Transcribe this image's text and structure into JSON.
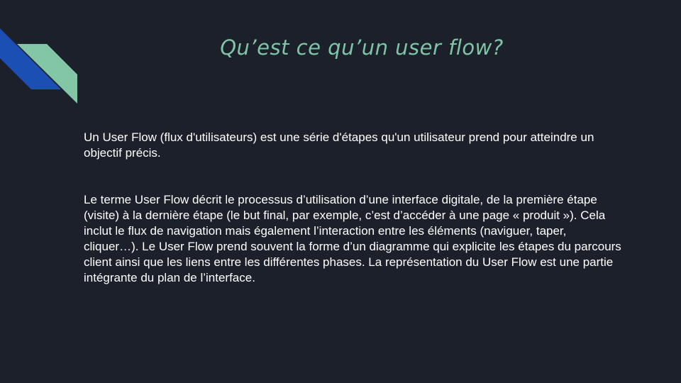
{
  "slide": {
    "title": "Qu’est ce qu’un user flow?",
    "paragraphs": [
      "Un User Flow (flux d'utilisateurs) est une série d'étapes qu'un utilisateur prend pour atteindre un objectif précis.",
      "Le terme User Flow décrit le processus d’utilisation d’une interface digitale, de la première étape (visite) à la dernière étape (le but final, par exemple, c’est d’accéder à une page « produit »). Cela inclut le flux de navigation mais également l’interaction entre les éléments (naviguer, taper, cliquer…). Le User Flow prend souvent la forme d’un diagramme qui explicite les étapes du parcours client ainsi que les liens entre les différentes phases. La représentation du User Flow est une partie intégrante du plan de l’interface."
    ]
  },
  "colors": {
    "background": "#1b202b",
    "title": "#7fc4a4",
    "body_text": "#ffffff",
    "accent_blue": "#1c4fb4",
    "accent_green": "#82c6a6"
  }
}
